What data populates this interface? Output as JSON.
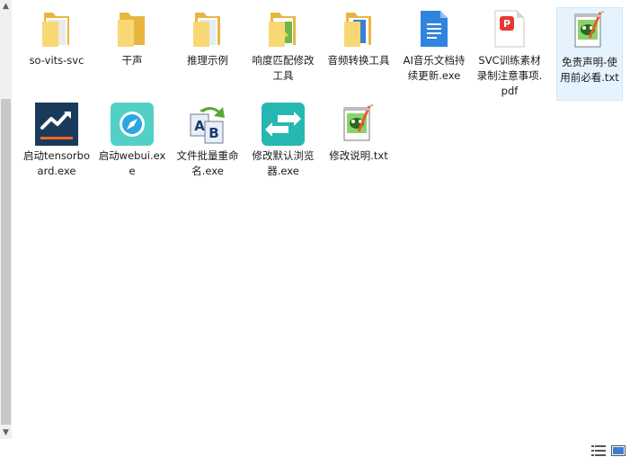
{
  "scrollbar": {
    "up_arrow": "▲",
    "down_arrow": "▼"
  },
  "items": [
    {
      "label": "so-vits-svc",
      "icon": "folder-icon"
    },
    {
      "label": "干声",
      "icon": "folder-icon"
    },
    {
      "label": "推理示例",
      "icon": "folder-icon"
    },
    {
      "label": "响度匹配修改工具",
      "icon": "folder-icon"
    },
    {
      "label": "音频转换工具",
      "icon": "folder-icon"
    },
    {
      "label": "AI音乐文档持续更新.exe",
      "icon": "document-exe-icon"
    },
    {
      "label": "SVC训练素材录制注意事项.pdf",
      "icon": "pdf-icon"
    },
    {
      "label": "免责声明-使用前必看.txt",
      "icon": "notepad-icon",
      "selected": true
    },
    {
      "label": "启动tensorboard.exe",
      "icon": "tensorboard-icon"
    },
    {
      "label": "启动webui.exe",
      "icon": "compass-icon"
    },
    {
      "label": "文件批量重命名.exe",
      "icon": "rename-icon"
    },
    {
      "label": "修改默认浏览器.exe",
      "icon": "browser-switch-icon"
    },
    {
      "label": "修改说明.txt",
      "icon": "notepad-icon"
    }
  ],
  "statusbar": {
    "views": [
      "details-view-icon",
      "large-icons-view-icon"
    ]
  },
  "colors": {
    "selection_bg": "#e5f3ff",
    "selection_border": "#cce8ff",
    "folder": "#f8d775",
    "tensorboard_bg": "#1a3a5c",
    "teal": "#26b8b0"
  }
}
